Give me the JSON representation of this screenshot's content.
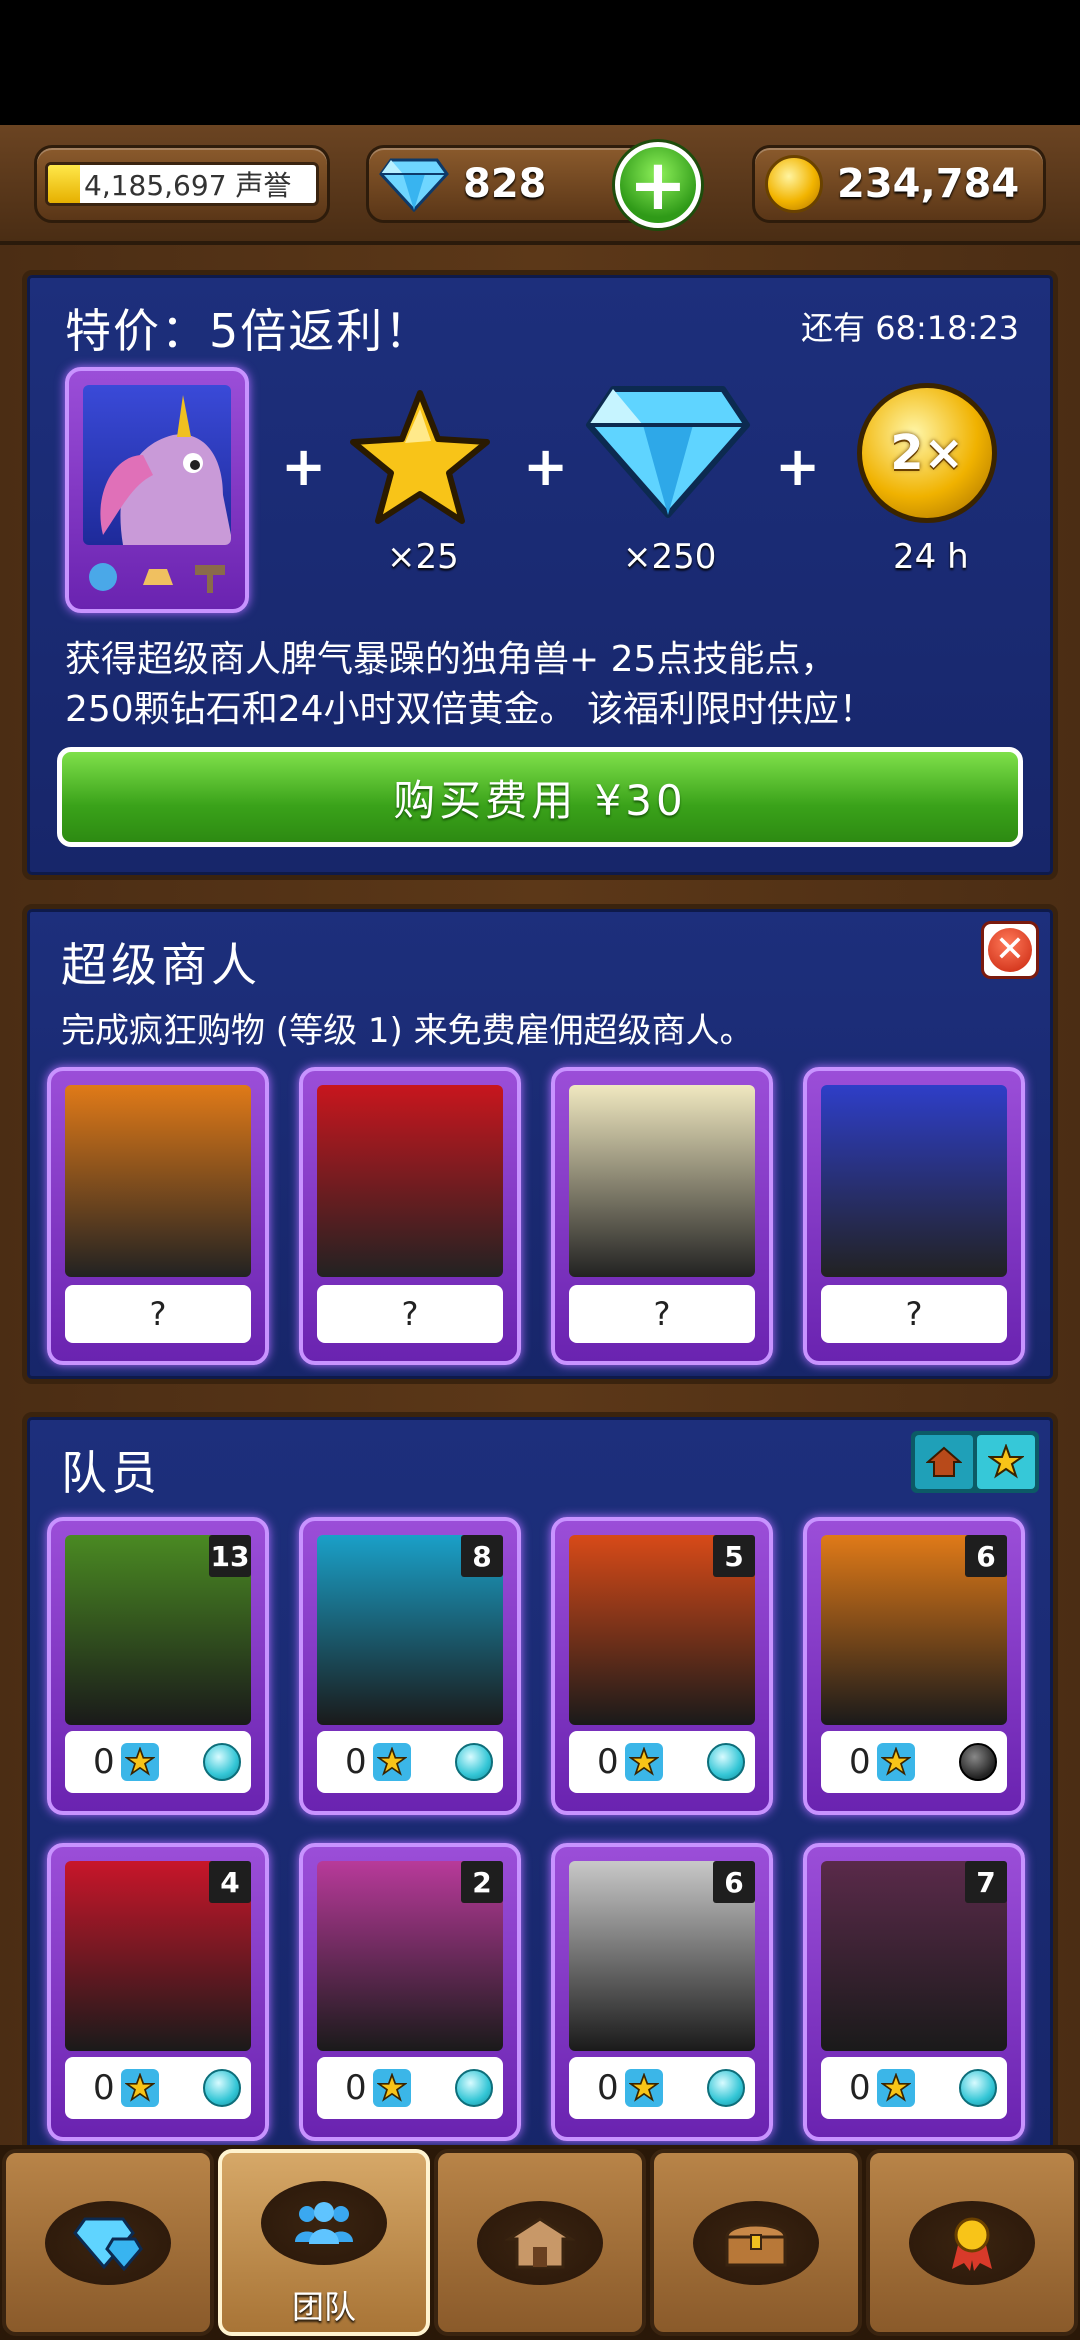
{
  "topbar": {
    "reputation": "4,185,697 声誉",
    "gems": "828",
    "gold": "234,784"
  },
  "offer": {
    "title": "特价：5倍返利！",
    "timer": "还有 68:18:23",
    "rewards": {
      "stars": "×25",
      "gems": "×250",
      "double": "24 h",
      "double_badge": "2×"
    },
    "description_line1": "获得超级商人脾气暴躁的独角兽+ 25点技能点，",
    "description_line2": "250颗钻石和24小时双倍黄金。 该福利限时供应！",
    "buy_label": "购买费用 ¥30"
  },
  "merchant": {
    "title": "超级商人",
    "description": "完成疯狂购物 (等级 1) 来免费雇佣超级商人。",
    "cards": [
      {
        "label": "?",
        "color": "#e07a18"
      },
      {
        "label": "?",
        "color": "#c8161e"
      },
      {
        "label": "?",
        "color": "#f0e8c0"
      },
      {
        "label": "?",
        "color": "#2e3ec8"
      }
    ]
  },
  "team": {
    "title": "队员",
    "members": [
      {
        "level": "13",
        "stars": "0",
        "color": "#4a8a22",
        "orb": "cyan"
      },
      {
        "level": "8",
        "stars": "0",
        "color": "#1aa0c8",
        "orb": "cyan"
      },
      {
        "level": "5",
        "stars": "0",
        "color": "#d84a18",
        "orb": "cyan"
      },
      {
        "level": "6",
        "stars": "0",
        "color": "#e07a18",
        "orb": "dark"
      },
      {
        "level": "4",
        "stars": "0",
        "color": "#c8162a",
        "orb": "cyan"
      },
      {
        "level": "2",
        "stars": "0",
        "color": "#b83a9a",
        "orb": "cyan"
      },
      {
        "level": "6",
        "stars": "0",
        "color": "#c8c8c8",
        "orb": "cyan"
      },
      {
        "level": "7",
        "stars": "0",
        "color": "#5a2a4a",
        "orb": "cyan"
      }
    ]
  },
  "nav": {
    "items": [
      {
        "icon": "gems-icon",
        "label": ""
      },
      {
        "icon": "team-icon",
        "label": "团队"
      },
      {
        "icon": "shop-icon",
        "label": ""
      },
      {
        "icon": "chest-icon",
        "label": ""
      },
      {
        "icon": "medal-icon",
        "label": ""
      }
    ]
  }
}
